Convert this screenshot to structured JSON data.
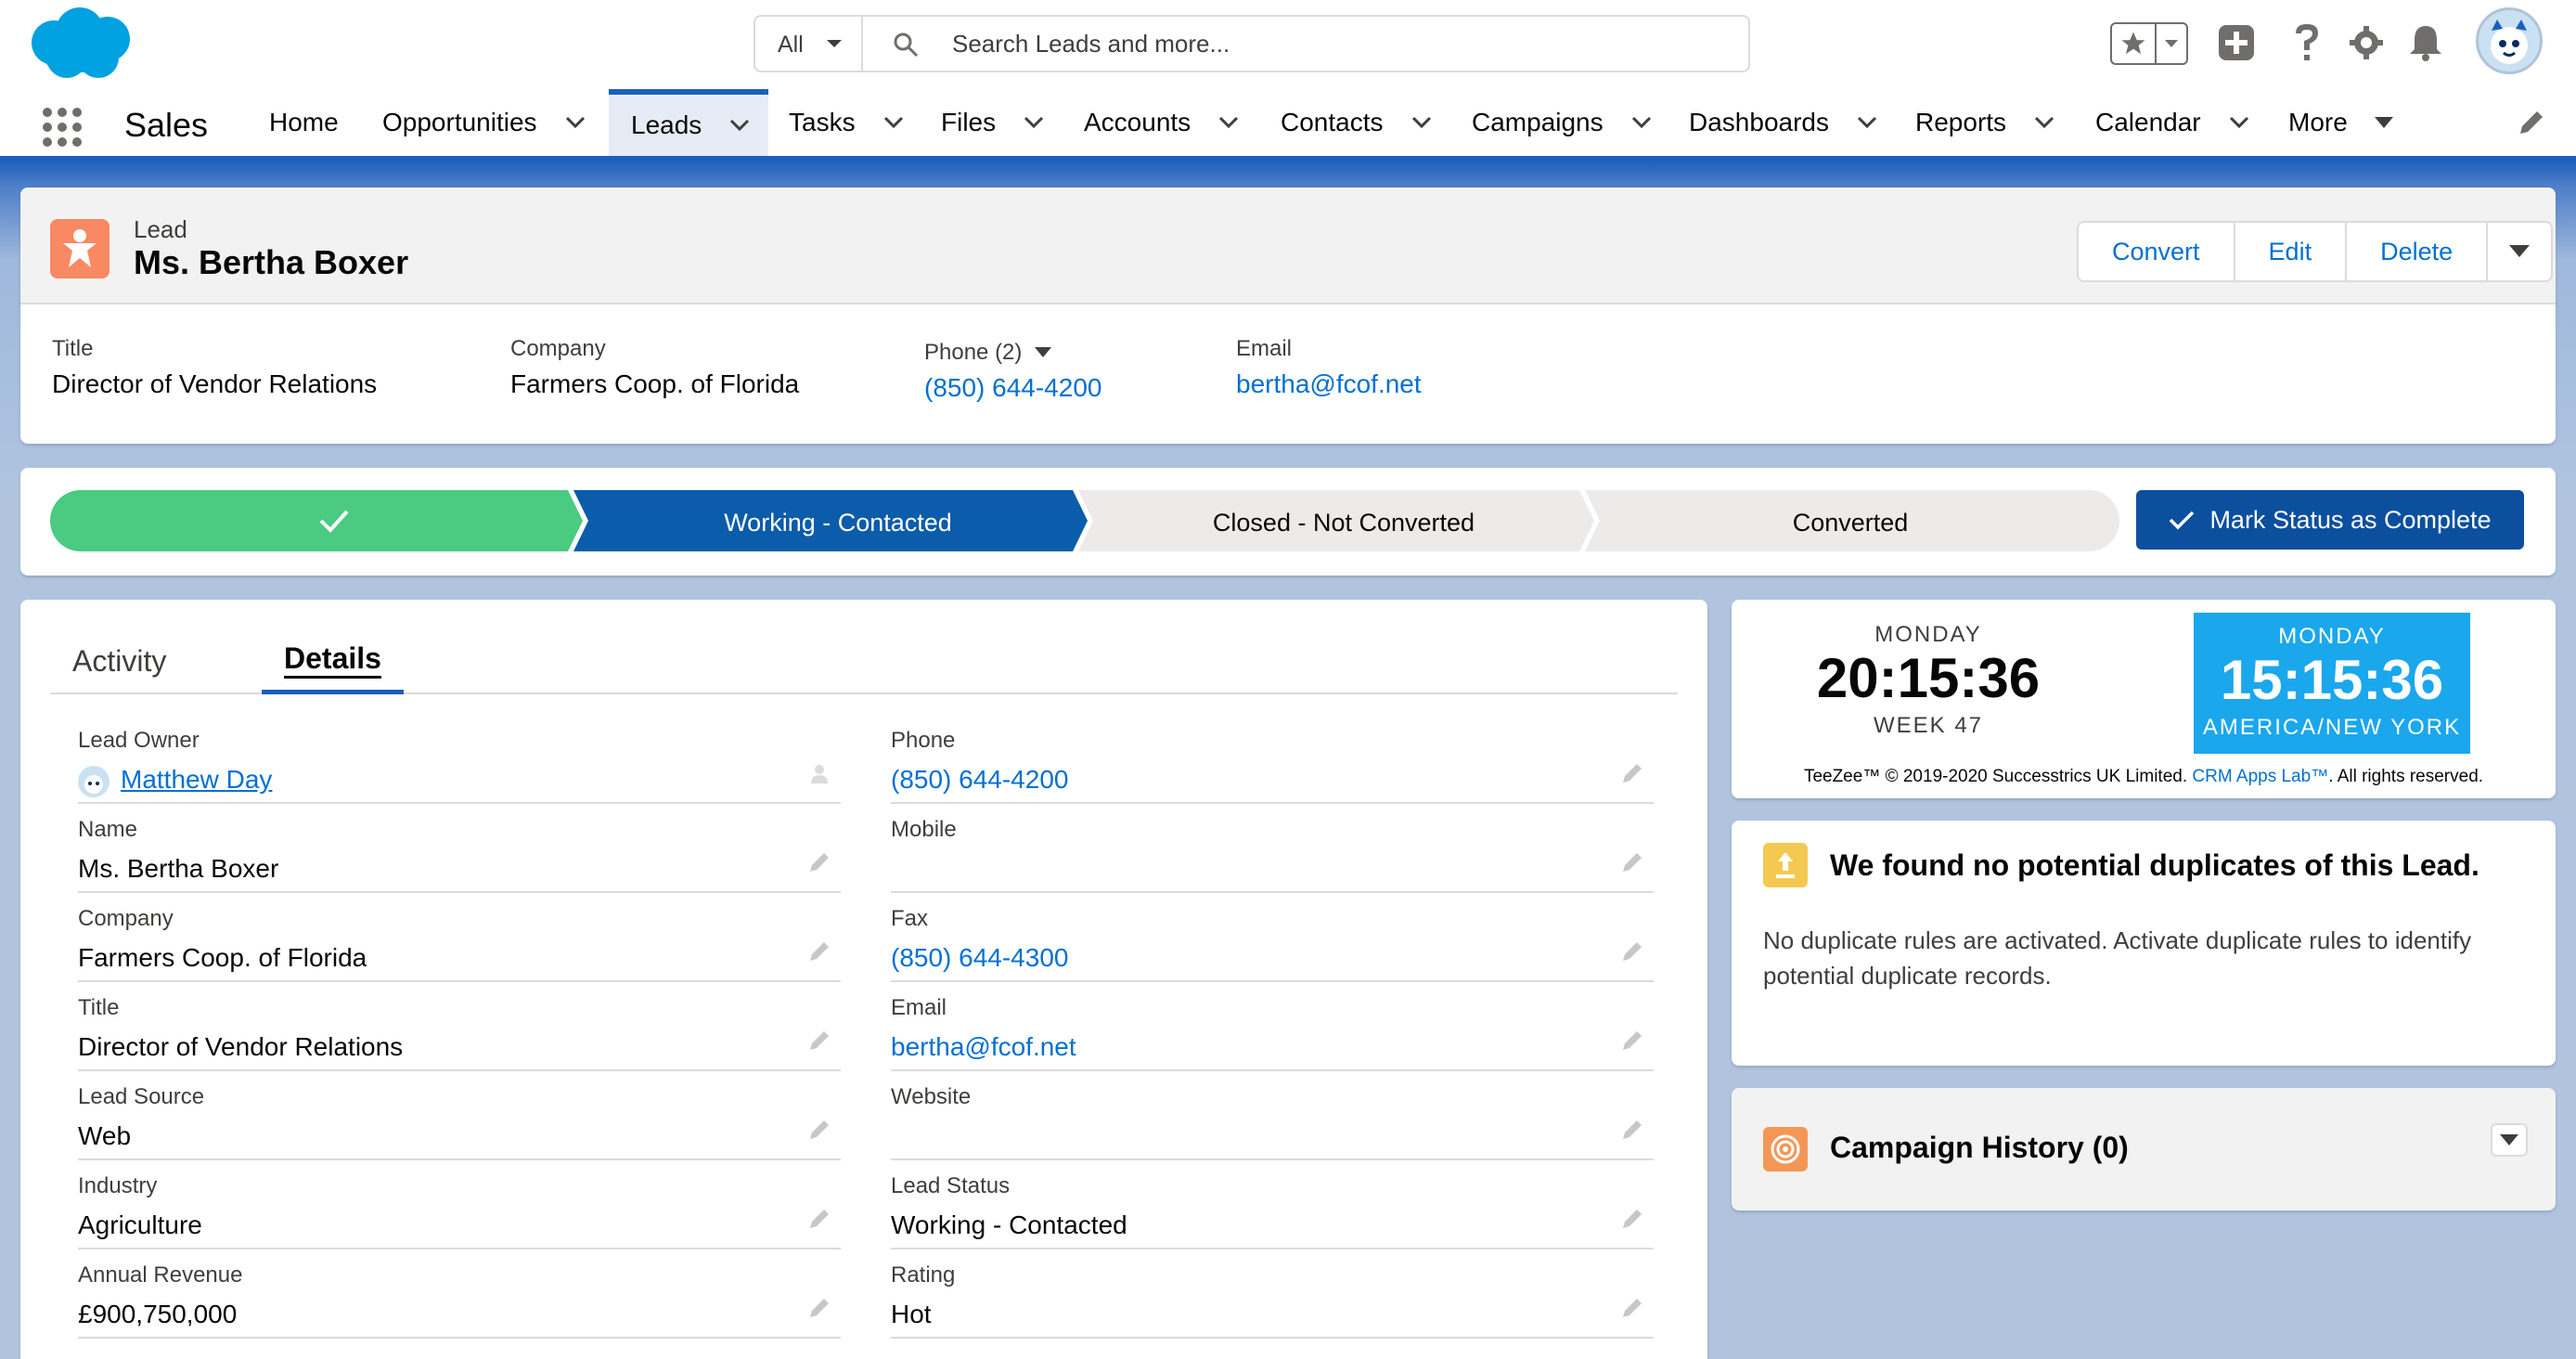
{
  "header": {
    "search_scope": "All",
    "search_placeholder": "Search Leads and more..."
  },
  "nav": {
    "app_name": "Sales",
    "items": [
      {
        "label": "Home",
        "has_menu": false
      },
      {
        "label": "Opportunities",
        "has_menu": true
      },
      {
        "label": "Leads",
        "has_menu": true,
        "active": true
      },
      {
        "label": "Tasks",
        "has_menu": true
      },
      {
        "label": "Files",
        "has_menu": true
      },
      {
        "label": "Accounts",
        "has_menu": true
      },
      {
        "label": "Contacts",
        "has_menu": true
      },
      {
        "label": "Campaigns",
        "has_menu": true
      },
      {
        "label": "Dashboards",
        "has_menu": true
      },
      {
        "label": "Reports",
        "has_menu": true
      },
      {
        "label": "Calendar",
        "has_menu": true
      },
      {
        "label": "More",
        "has_menu": true
      }
    ]
  },
  "record": {
    "object_type": "Lead",
    "name": "Ms. Bertha Boxer",
    "actions": {
      "convert": "Convert",
      "edit": "Edit",
      "delete": "Delete"
    },
    "highlights": {
      "title_label": "Title",
      "title_value": "Director of Vendor Relations",
      "company_label": "Company",
      "company_value": "Farmers Coop. of Florida",
      "phone_label": "Phone (2)",
      "phone_value": "(850) 644-4200",
      "email_label": "Email",
      "email_value": "bertha@fcof.net"
    }
  },
  "path": {
    "stages": [
      "",
      "Working - Contacted",
      "Closed - Not Converted",
      "Converted"
    ],
    "current_index": 1,
    "mark_button": "Mark Status as Complete",
    "colors": {
      "complete": "#4bca81",
      "current": "#0b5cab",
      "incomplete": "#ecebea"
    }
  },
  "details": {
    "tabs": {
      "activity": "Activity",
      "details": "Details"
    },
    "left": [
      {
        "label": "Lead Owner",
        "value": "Matthew Day",
        "link": true
      },
      {
        "label": "Name",
        "value": "Ms. Bertha Boxer"
      },
      {
        "label": "Company",
        "value": "Farmers Coop. of Florida"
      },
      {
        "label": "Title",
        "value": "Director of Vendor Relations"
      },
      {
        "label": "Lead Source",
        "value": "Web"
      },
      {
        "label": "Industry",
        "value": "Agriculture"
      },
      {
        "label": "Annual Revenue",
        "value": "£900,750,000"
      }
    ],
    "right": [
      {
        "label": "Phone",
        "value": "(850) 644-4200",
        "link": true
      },
      {
        "label": "Mobile",
        "value": ""
      },
      {
        "label": "Fax",
        "value": "(850) 644-4300",
        "link": true
      },
      {
        "label": "Email",
        "value": "bertha@fcof.net",
        "link": true
      },
      {
        "label": "Website",
        "value": ""
      },
      {
        "label": "Lead Status",
        "value": "Working - Contacted"
      },
      {
        "label": "Rating",
        "value": "Hot"
      }
    ]
  },
  "clock": {
    "local_day": "MONDAY",
    "local_time": "20:15:36",
    "local_week": "WEEK 47",
    "remote_day": "MONDAY",
    "remote_time": "15:15:36",
    "remote_zone": "AMERICA/NEW YORK",
    "footer_pre": "TeeZee™ © 2019-2020 Successtrics UK Limited.",
    "footer_link": "CRM Apps Lab™",
    "footer_post": ". All rights reserved."
  },
  "duplicates": {
    "title": "We found no potential duplicates of this Lead.",
    "body": "No duplicate rules are activated. Activate duplicate rules to identify potential duplicate records."
  },
  "campaign": {
    "title": "Campaign History (0)"
  }
}
